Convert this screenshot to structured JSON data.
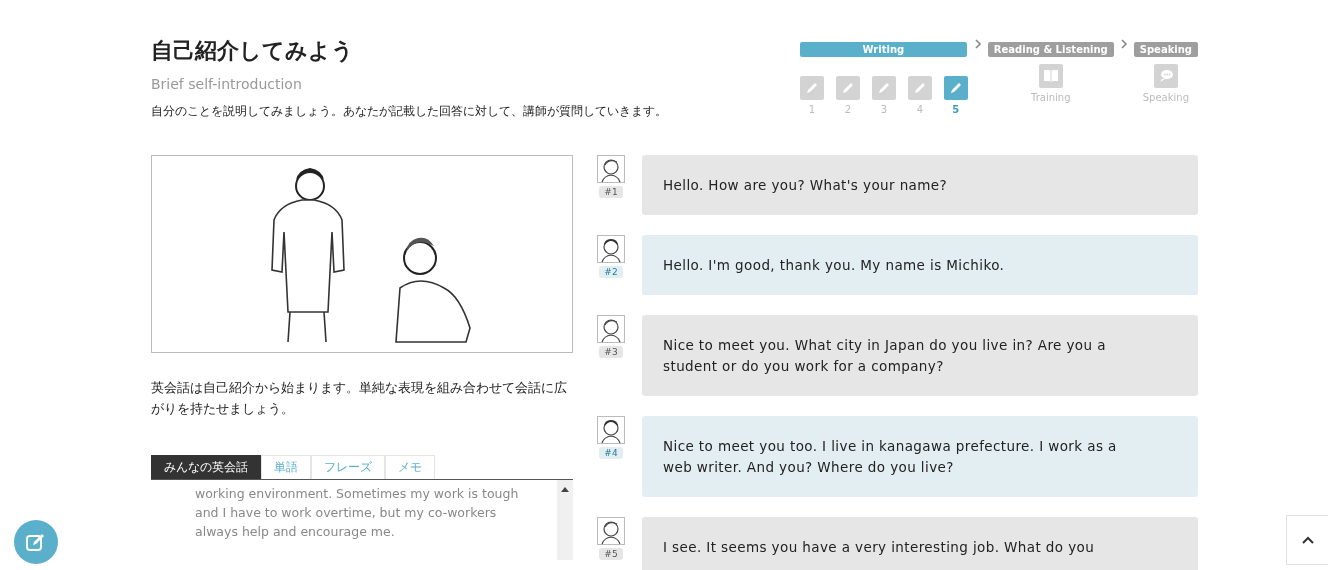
{
  "title": "自己紹介してみよう",
  "subtitle": "Brief self-introduction",
  "description": "自分のことを説明してみましょう。あなたが記載した回答に対して、講師が質問していきます。",
  "progress": {
    "stages": [
      {
        "label": "Writing",
        "selected": true,
        "kind": "steps",
        "steps": [
          {
            "label": "1",
            "selected": false
          },
          {
            "label": "2",
            "selected": false
          },
          {
            "label": "3",
            "selected": false
          },
          {
            "label": "4",
            "selected": false
          },
          {
            "label": "5",
            "selected": true
          }
        ]
      },
      {
        "label": "Reading & Listening",
        "selected": false,
        "kind": "single",
        "icon_label": "Training"
      },
      {
        "label": "Speaking",
        "selected": false,
        "kind": "single",
        "icon_label": "Speaking"
      }
    ]
  },
  "intro": "英会話は自己紹介から始まります。単純な表現を組み合わせて会話に広がりを持たせましょう。",
  "tabs": [
    {
      "label": "みんなの英会話",
      "selected": true
    },
    {
      "label": "単語",
      "selected": false
    },
    {
      "label": "フレーズ",
      "selected": false
    },
    {
      "label": "メモ",
      "selected": false
    }
  ],
  "answer_text": "working environment. Sometimes my work is tough and I have to work overtime, but my co-workers always help and encourage me.",
  "messages": [
    {
      "kind": "teacher",
      "number": "#1",
      "text": "Hello. How are you? What's your name?"
    },
    {
      "kind": "student",
      "number": "#2",
      "text": "Hello. I'm good, thank you. My name is Michiko."
    },
    {
      "kind": "teacher",
      "number": "#3",
      "text": "Nice to meet you. What city in Japan do you live in? Are you a student or do you work for a company?"
    },
    {
      "kind": "student",
      "number": "#4",
      "text": "Nice to meet you too. I live in kanagawa prefecture. I work as a web writer. And you? Where do you live?"
    },
    {
      "kind": "teacher",
      "number": "#5",
      "text": "I see. It seems you have a very interesting job. What do you"
    }
  ]
}
